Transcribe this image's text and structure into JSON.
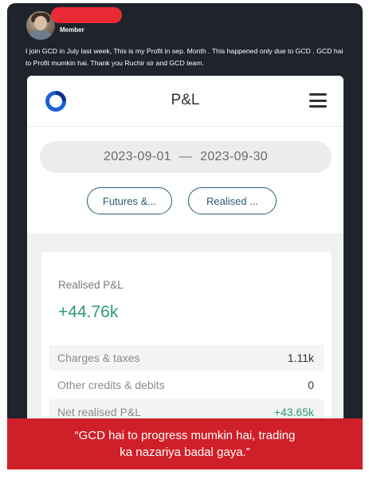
{
  "post": {
    "role": "Member",
    "text": "I join GCD in July last week, This is my Profit in sep. Month . This happened only due to GCD . GCD hai to Profit mumkin hai. Thank you Ruchir sir and GCD team."
  },
  "app": {
    "title": "P&L",
    "date_from": "2023-09-01",
    "date_separator": "—",
    "date_to": "2023-09-30",
    "filters": [
      "Futures &...",
      "Realised ..."
    ],
    "summary": {
      "label": "Realised P&L",
      "value": "+44.76k",
      "rows": [
        {
          "label": "Charges & taxes",
          "value": "1.11k"
        },
        {
          "label": "Other credits & debits",
          "value": "0"
        },
        {
          "label": "Net realised P&L",
          "value": "+43.65k"
        }
      ]
    }
  },
  "quote": {
    "line1": "“GCD hai to progress mumkin hai, trading",
    "line2": "ka nazariya badal gaya.”"
  },
  "colors": {
    "card_bg": "#1f232b",
    "accent_red": "#cf1f28",
    "profit_green": "#2e9b6f",
    "pill_border": "#2c5b74",
    "logo_blue": "#1d5fd6"
  },
  "icons": {
    "logo": "circle-ring-logo-icon",
    "menu": "hamburger-menu-icon"
  }
}
